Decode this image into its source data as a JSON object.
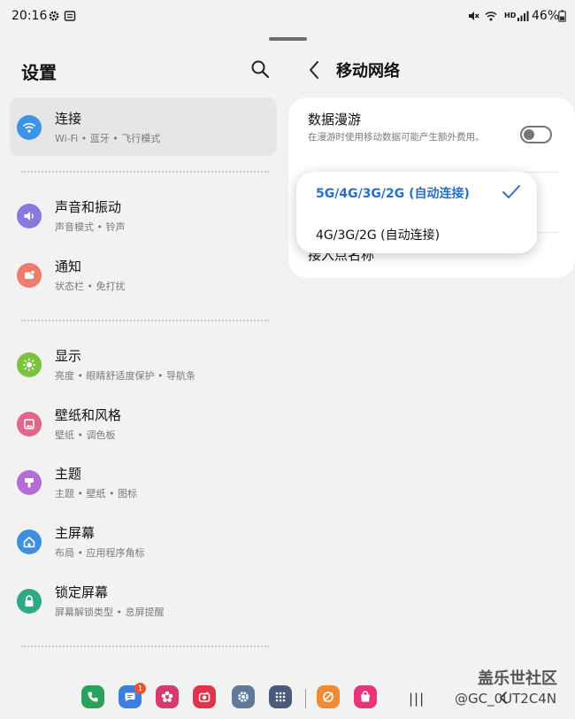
{
  "status_bar": {
    "time": "20:16",
    "network": "HD",
    "battery": "46%"
  },
  "left": {
    "title": "设置",
    "items": [
      {
        "title": "连接",
        "subtitle": "Wi-Fi • 蓝牙 • 飞行模式",
        "icon": "wifi-icon",
        "color": "#3d94e6"
      },
      {
        "title": "声音和振动",
        "subtitle": "声音模式 • 铃声",
        "icon": "speaker-icon",
        "color": "#8a78e0"
      },
      {
        "title": "通知",
        "subtitle": "状态栏 • 免打扰",
        "icon": "bell-icon",
        "color": "#f07a6b"
      },
      {
        "title": "显示",
        "subtitle": "亮度 • 眼睛舒适度保护 • 导航条",
        "icon": "sun-icon",
        "color": "#7bc23e"
      },
      {
        "title": "壁纸和风格",
        "subtitle": "壁纸 • 调色板",
        "icon": "picture-icon",
        "color": "#e0668a"
      },
      {
        "title": "主题",
        "subtitle": "主题 • 壁纸 • 图标",
        "icon": "brush-icon",
        "color": "#b56cd6"
      },
      {
        "title": "主屏幕",
        "subtitle": "布局 • 应用程序角标",
        "icon": "home-icon",
        "color": "#3e8fe0"
      },
      {
        "title": "锁定屏幕",
        "subtitle": "屏幕解锁类型 • 息屏提醒",
        "icon": "lock-icon",
        "color": "#2ea886"
      }
    ]
  },
  "right": {
    "title": "移动网络",
    "roaming": {
      "title": "数据漫游",
      "description": "在漫游时使用移动数据可能产生额外费用。"
    },
    "apn_label": "接入点名称",
    "popup_options": [
      {
        "label": "5G/4G/3G/2G (自动连接)",
        "selected": true
      },
      {
        "label": "4G/3G/2G (自动连接)",
        "selected": false
      }
    ]
  },
  "dock": {
    "apps": [
      {
        "icon": "phone-icon",
        "color": "#2aa05a"
      },
      {
        "icon": "messages-icon",
        "color": "#3d7fe0"
      },
      {
        "icon": "gallery-icon",
        "color": "#d63a6e"
      },
      {
        "icon": "camera-icon",
        "color": "#e0344a"
      },
      {
        "icon": "settings-icon",
        "color": "#5e7a96"
      },
      {
        "icon": "app-drawer-icon",
        "color": "#4a5a7a"
      },
      {
        "icon": "browser-icon",
        "color": "#f08a34"
      },
      {
        "icon": "store-icon",
        "color": "#e8357a"
      }
    ],
    "messages_badge": "1"
  },
  "watermark": {
    "main": "盖乐世社区",
    "sub": "@GC_0UT2C4N"
  },
  "colors": {
    "accent": "#2a6fc7",
    "selected_bg": "#e6e6e6"
  }
}
